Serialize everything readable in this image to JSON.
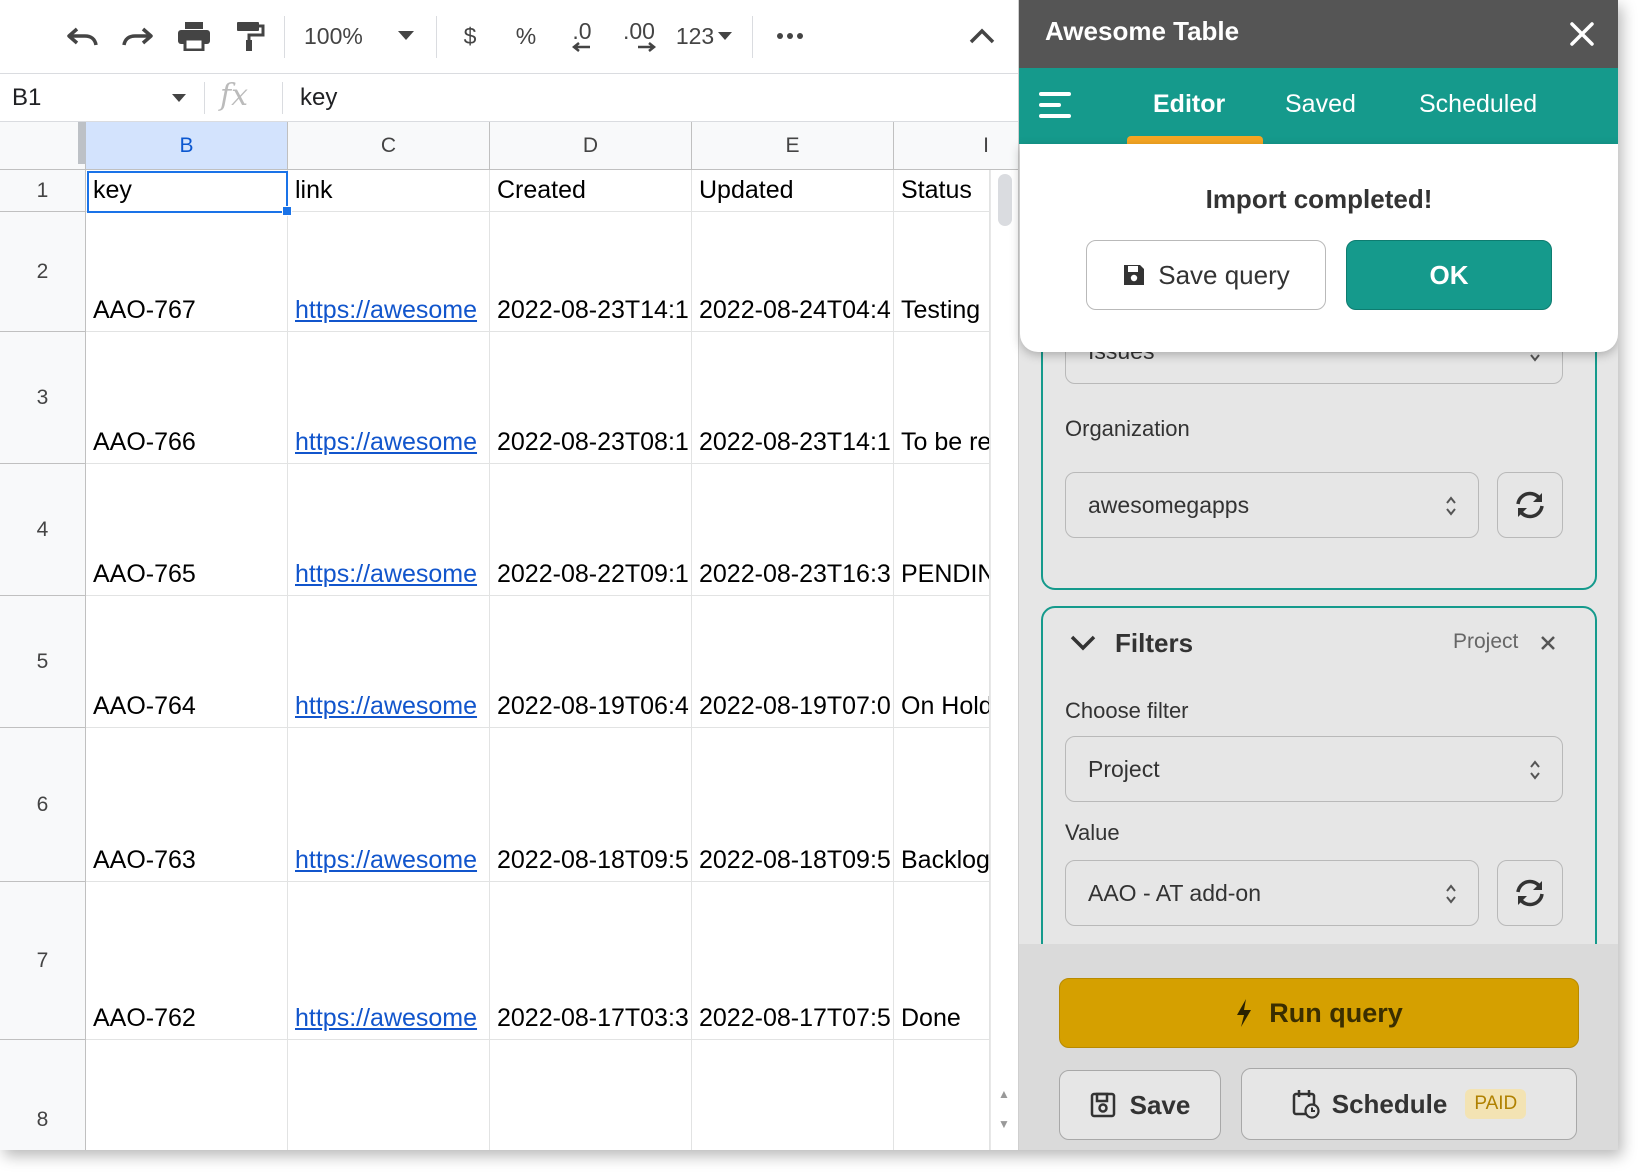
{
  "toolbar": {
    "zoom": "100%",
    "currency": "$",
    "percent": "%",
    "decimal_decrease": ".0",
    "decimal_increase": ".00",
    "number_format": "123"
  },
  "formula_bar": {
    "cell_ref": "B1",
    "fx": "fx",
    "value": "key"
  },
  "grid": {
    "columns": [
      "B",
      "C",
      "D",
      "E",
      "I"
    ],
    "rows": [
      "1",
      "2",
      "3",
      "4",
      "5",
      "6",
      "7",
      "8"
    ],
    "header_row": [
      "key",
      "link",
      "Created",
      "Updated",
      "Status"
    ],
    "data": [
      [
        "AAO-767",
        "https://awesome",
        "2022-08-23T14:1",
        "2022-08-24T04:4",
        "Testing"
      ],
      [
        "AAO-766",
        "https://awesome",
        "2022-08-23T08:1",
        "2022-08-23T14:1",
        "To be re"
      ],
      [
        "AAO-765",
        "https://awesome",
        "2022-08-22T09:1",
        "2022-08-23T16:3",
        "PENDIN"
      ],
      [
        "AAO-764",
        "https://awesome",
        "2022-08-19T06:4",
        "2022-08-19T07:0",
        "On Hold"
      ],
      [
        "AAO-763",
        "https://awesome",
        "2022-08-18T09:5",
        "2022-08-18T09:5",
        "Backlog"
      ],
      [
        "AAO-762",
        "https://awesome",
        "2022-08-17T03:3",
        "2022-08-17T07:5",
        "Done"
      ]
    ]
  },
  "sidebar": {
    "title": "Awesome Table",
    "tabs": [
      "Editor",
      "Saved",
      "Scheduled"
    ],
    "active_tab": "Editor",
    "data_type_value": "Issues",
    "organization_label": "Organization",
    "organization_value": "awesomegapps",
    "filters_title": "Filters",
    "filters_tag": "Project",
    "choose_filter_label": "Choose filter",
    "choose_filter_value": "Project",
    "value_label": "Value",
    "value_value": "AAO - AT add-on",
    "popup_message": "Import completed!",
    "save_query_label": "Save query",
    "ok_label": "OK",
    "run_query_label": "Run query",
    "save_label": "Save",
    "schedule_label": "Schedule",
    "paid_badge": "PAID",
    "colors": {
      "teal": "#159a8c",
      "header_gray": "#555555",
      "run_gold": "#d5a000",
      "tab_underline": "#f5a623",
      "link_blue": "#1155cc",
      "selection_blue": "#1a73e8"
    }
  }
}
